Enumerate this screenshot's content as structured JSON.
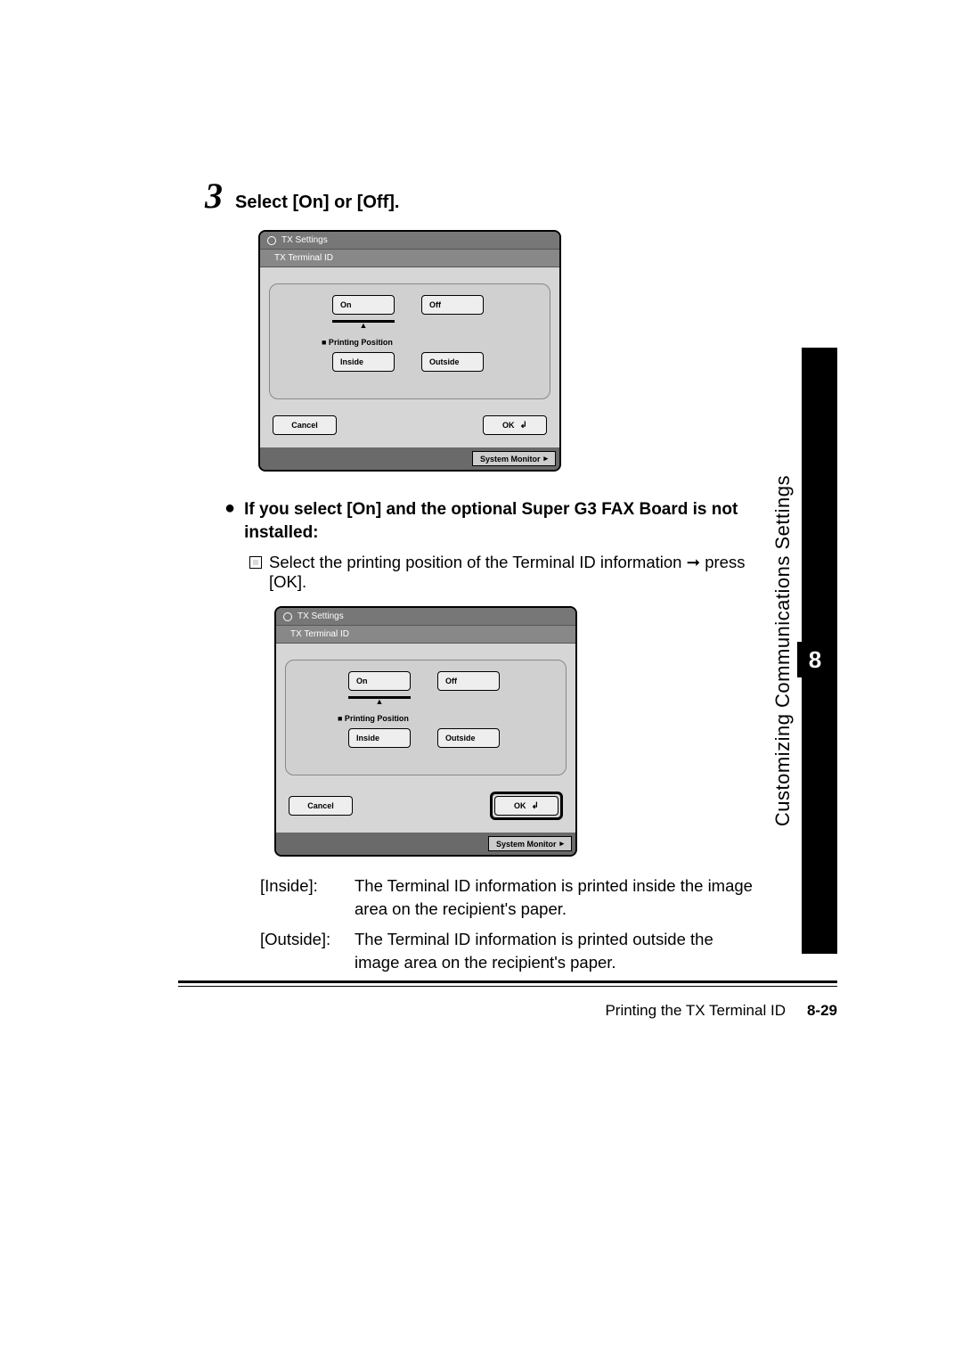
{
  "step": {
    "number": "3",
    "title": "Select [On] or [Off]."
  },
  "screenshot_a": {
    "bar1": "TX Settings",
    "bar2": "TX Terminal ID",
    "on": "On",
    "off": "Off",
    "pp_label": "■ Printing Position",
    "inside": "Inside",
    "outside": "Outside",
    "cancel": "Cancel",
    "ok": "OK",
    "sysmon": "System Monitor"
  },
  "cond": {
    "heading": "If you select [On] and the optional Super G3 FAX Board is not installed:",
    "sub": "Select the printing position of the Terminal ID information ➞ press [OK]."
  },
  "screenshot_b": {
    "bar1": "TX Settings",
    "bar2": "TX Terminal ID",
    "on": "On",
    "off": "Off",
    "pp_label": "■ Printing Position",
    "inside": "Inside",
    "outside": "Outside",
    "cancel": "Cancel",
    "ok": "OK",
    "sysmon": "System Monitor"
  },
  "defs": {
    "inside_key": "[Inside]:",
    "inside_val": "The Terminal ID information is printed inside the image area on the recipient's paper.",
    "outside_key": "[Outside]:",
    "outside_val": "The Terminal ID information is printed outside the image area on the recipient's paper."
  },
  "side": {
    "text": "Customizing Communications Settings",
    "num": "8"
  },
  "footer": {
    "title": "Printing the TX Terminal ID",
    "page": "8-29"
  }
}
